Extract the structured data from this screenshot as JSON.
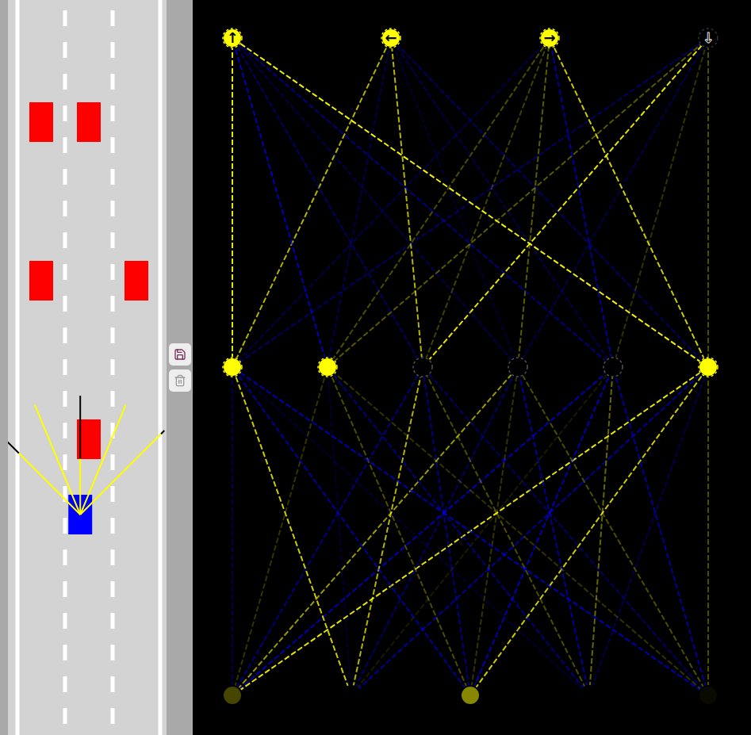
{
  "road": {
    "lanes": 3
  },
  "player": {
    "lane": 1,
    "offset": -0.18,
    "damaged": false,
    "color": "#0000ff"
  },
  "traffic": [
    {
      "lane": 0,
      "distance_ahead": 495,
      "color": "#ff0000"
    },
    {
      "lane": 1,
      "distance_ahead": 495,
      "color": "#ff0000"
    },
    {
      "lane": 0,
      "distance_ahead": 295,
      "color": "#ff0000"
    },
    {
      "lane": 2,
      "distance_ahead": 295,
      "color": "#ff0000"
    },
    {
      "lane": 1,
      "distance_ahead": 95,
      "color": "#ff0000"
    }
  ],
  "sensors": [
    {
      "reading": 0.73
    },
    {
      "reading": 1
    },
    {
      "reading": 0.47
    },
    {
      "reading": 1
    },
    {
      "reading": 0.96
    }
  ],
  "network": {
    "outputs": [
      {
        "label": "↑",
        "on": true
      },
      {
        "label": "←",
        "on": true
      },
      {
        "label": "→",
        "on": true
      },
      {
        "label": "↓",
        "on": false
      }
    ],
    "hidden": [
      {
        "on": true
      },
      {
        "on": true
      },
      {
        "on": false
      },
      {
        "on": false
      },
      {
        "on": false
      },
      {
        "on": true
      }
    ],
    "weights_input_hidden": [
      [
        -0.3,
        0.2,
        -0.5,
        0.6,
        -0.7,
        0.9
      ],
      [
        0.8,
        -0.2,
        0.7,
        -0.4,
        0.1,
        -0.6
      ],
      [
        -0.6,
        0.3,
        -0.5,
        0.2,
        -0.7,
        0.8
      ],
      [
        -0.2,
        -0.5,
        0.3,
        -0.6,
        0.4,
        -0.3
      ],
      [
        -0.7,
        0.2,
        -0.4,
        0.3,
        -0.6,
        0.3
      ]
    ],
    "weights_hidden_output": [
      [
        0.9,
        0.7,
        -0.3,
        -0.4
      ],
      [
        -0.7,
        -0.3,
        0.3,
        0.35
      ],
      [
        -0.4,
        0.7,
        0.25,
        0.9
      ],
      [
        -0.3,
        -0.2,
        0.35,
        -0.3
      ],
      [
        -0.5,
        -0.3,
        -0.6,
        0.2
      ],
      [
        0.95,
        -0.4,
        0.8,
        0.3
      ]
    ]
  }
}
